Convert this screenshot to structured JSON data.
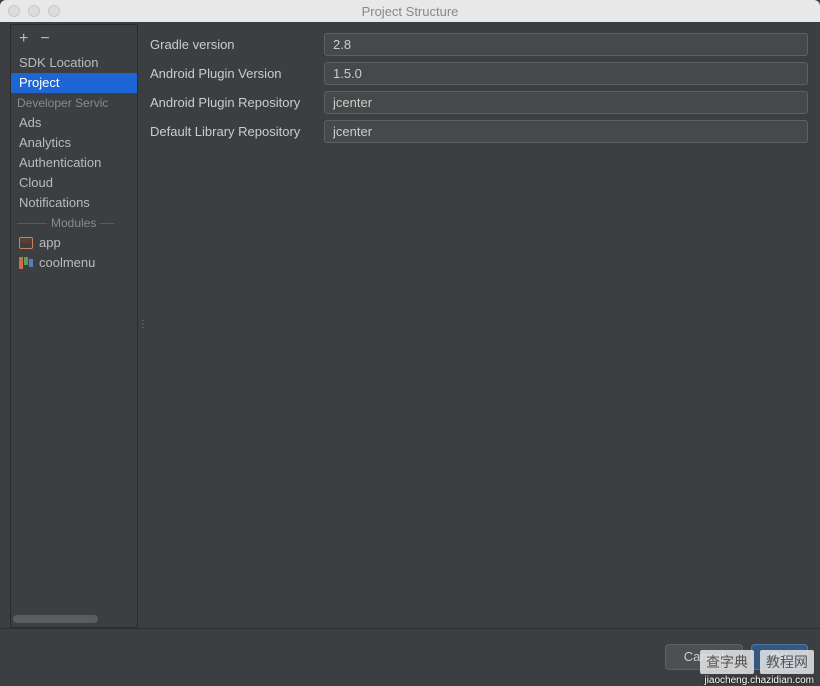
{
  "window": {
    "title": "Project Structure"
  },
  "sidebar": {
    "items": [
      {
        "label": "SDK Location"
      },
      {
        "label": "Project"
      }
    ],
    "section_dev": "Developer Servic",
    "dev_items": [
      {
        "label": "Ads"
      },
      {
        "label": "Analytics"
      },
      {
        "label": "Authentication"
      },
      {
        "label": "Cloud"
      },
      {
        "label": "Notifications"
      }
    ],
    "section_modules": "Modules",
    "modules": [
      {
        "label": "app"
      },
      {
        "label": "coolmenu"
      }
    ]
  },
  "form": {
    "rows": [
      {
        "label": "Gradle version",
        "value": "2.8"
      },
      {
        "label": "Android Plugin Version",
        "value": "1.5.0"
      },
      {
        "label": "Android Plugin Repository",
        "value": "jcenter"
      },
      {
        "label": "Default Library Repository",
        "value": "jcenter"
      }
    ]
  },
  "buttons": {
    "cancel": "Cancel",
    "ok": "OK"
  },
  "watermark": {
    "a": "查字典",
    "b": "教程网",
    "url": "jiaocheng.chazidian.com"
  }
}
